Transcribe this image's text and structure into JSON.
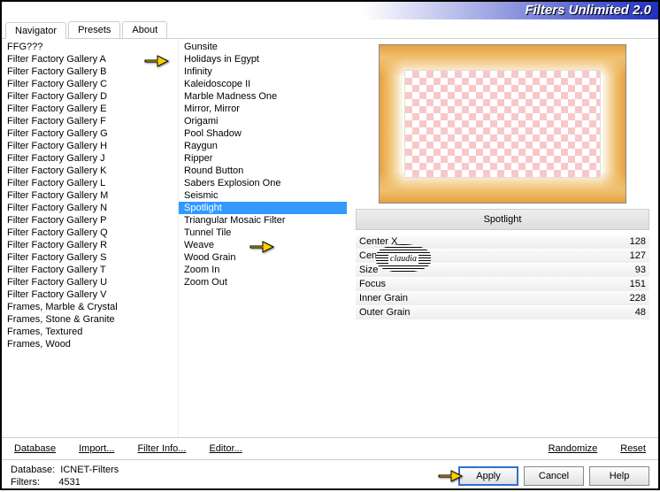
{
  "app": {
    "title": "Filters Unlimited 2.0"
  },
  "tabs": [
    "Navigator",
    "Presets",
    "About"
  ],
  "active_tab": 0,
  "categories": [
    "FFG???",
    "Filter Factory Gallery A",
    "Filter Factory Gallery B",
    "Filter Factory Gallery C",
    "Filter Factory Gallery D",
    "Filter Factory Gallery E",
    "Filter Factory Gallery F",
    "Filter Factory Gallery G",
    "Filter Factory Gallery H",
    "Filter Factory Gallery J",
    "Filter Factory Gallery K",
    "Filter Factory Gallery L",
    "Filter Factory Gallery M",
    "Filter Factory Gallery N",
    "Filter Factory Gallery P",
    "Filter Factory Gallery Q",
    "Filter Factory Gallery R",
    "Filter Factory Gallery S",
    "Filter Factory Gallery T",
    "Filter Factory Gallery U",
    "Filter Factory Gallery V",
    "Frames, Marble & Crystal",
    "Frames, Stone & Granite",
    "Frames, Textured",
    "Frames, Wood"
  ],
  "selected_category": 1,
  "filters": [
    "Gunsite",
    "Holidays in Egypt",
    "Infinity",
    "Kaleidoscope II",
    "Marble Madness One",
    "Mirror, Mirror",
    "Origami",
    "Pool Shadow",
    "Raygun",
    "Ripper",
    "Round Button",
    "Sabers Explosion One",
    "Seismic",
    "Spotlight",
    "Triangular Mosaic Filter",
    "Tunnel Tile",
    "Weave",
    "Wood Grain",
    "Zoom In",
    "Zoom Out"
  ],
  "selected_filter": 13,
  "current_filter_name": "Spotlight",
  "params": [
    {
      "label": "Center X",
      "value": "128"
    },
    {
      "label": "Center Y",
      "value": "127"
    },
    {
      "label": "Size",
      "value": "93"
    },
    {
      "label": "Focus",
      "value": "151"
    },
    {
      "label": "Inner Grain",
      "value": "228"
    },
    {
      "label": "Outer Grain",
      "value": "48"
    }
  ],
  "bottom_links": {
    "database": "Database",
    "import": "Import...",
    "filter_info": "Filter Info...",
    "editor": "Editor...",
    "randomize": "Randomize",
    "reset": "Reset"
  },
  "status": {
    "db_label": "Database:",
    "db_value": "ICNET-Filters",
    "flt_label": "Filters:",
    "flt_value": "4531"
  },
  "buttons": {
    "apply": "Apply",
    "cancel": "Cancel",
    "help": "Help"
  },
  "watermark": "claudia"
}
